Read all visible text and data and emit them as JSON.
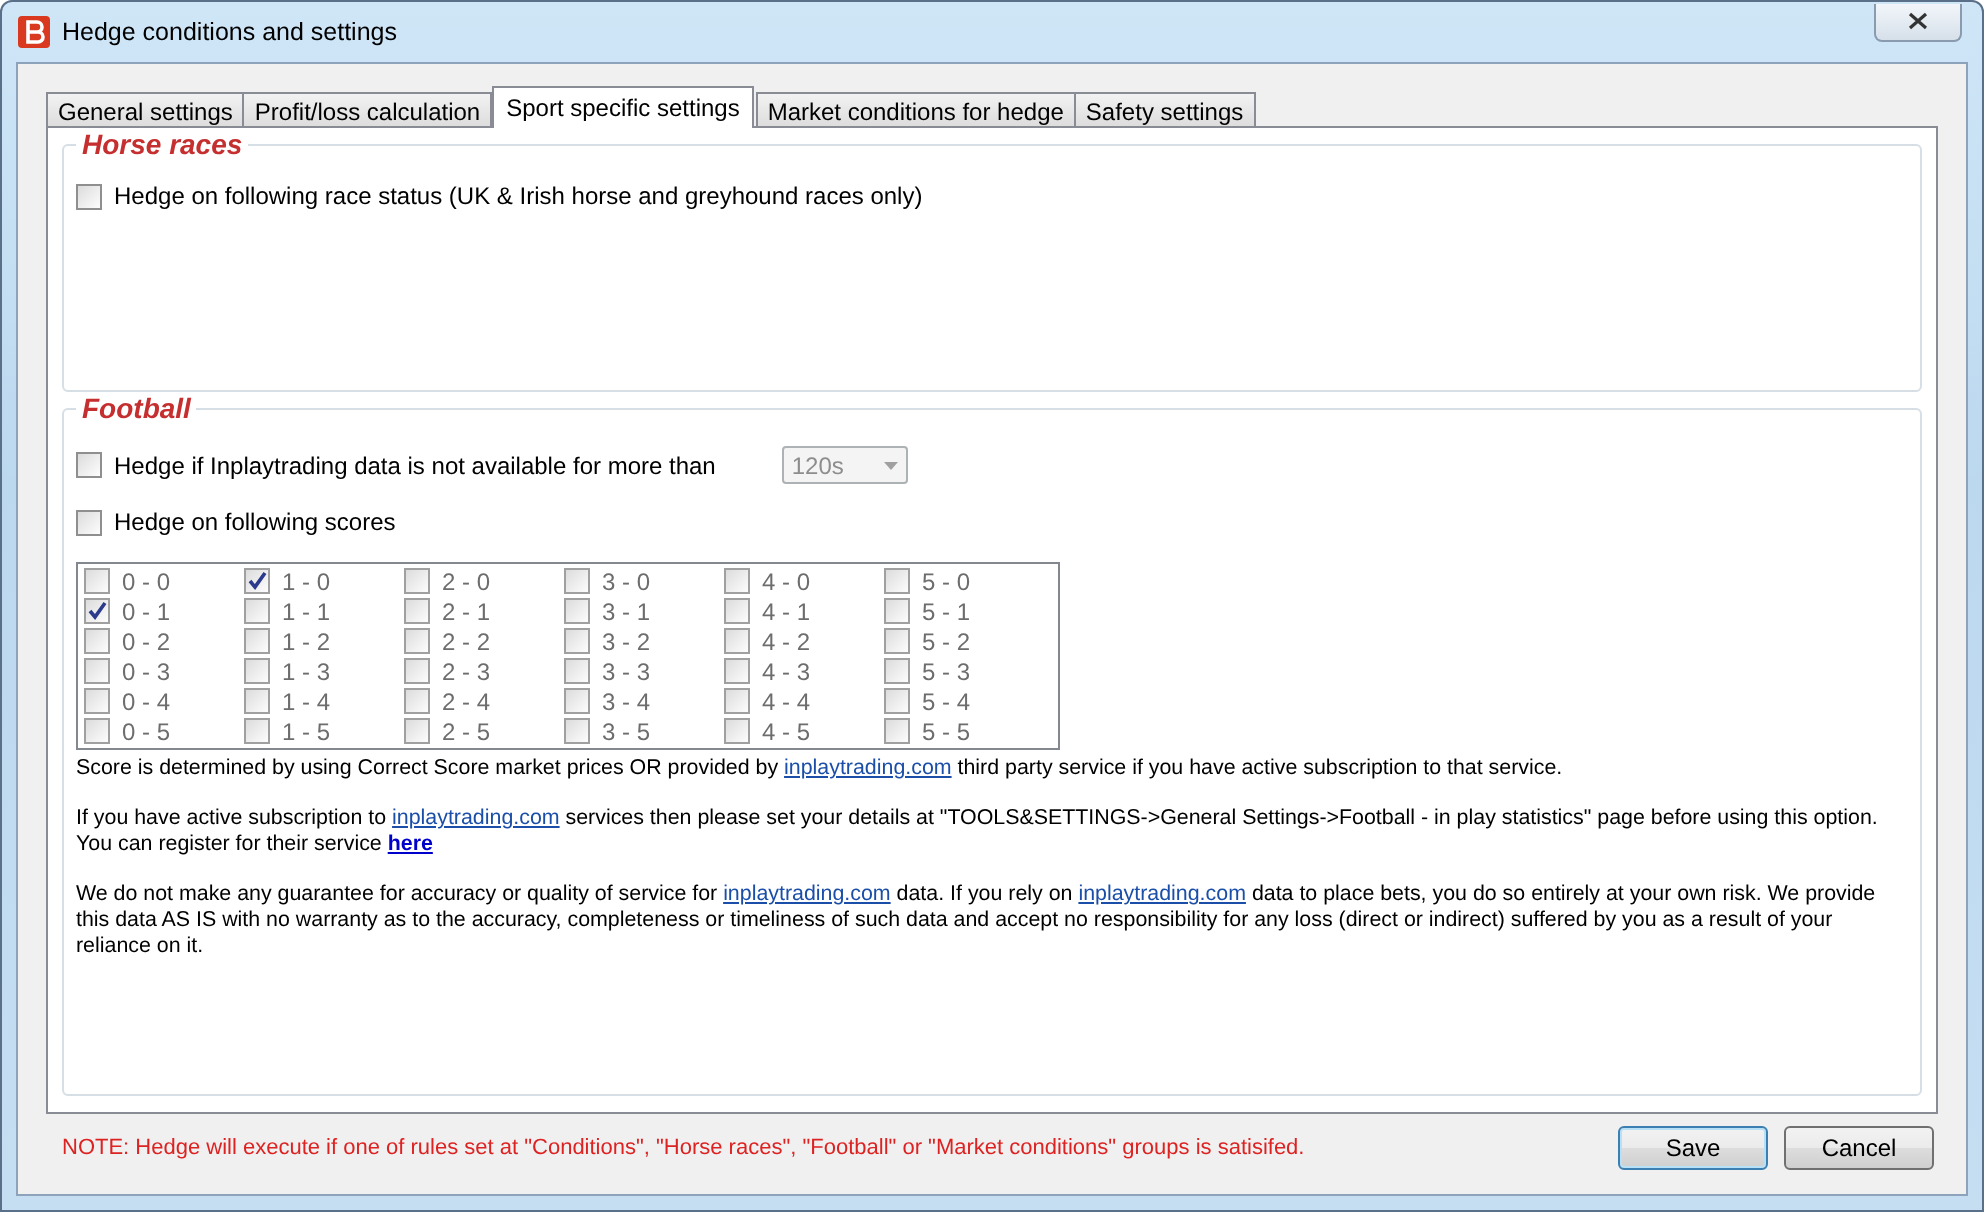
{
  "window": {
    "title": "Hedge conditions and settings"
  },
  "tabs": [
    {
      "label": "General settings",
      "selected": false
    },
    {
      "label": "Profit/loss calculation",
      "selected": false
    },
    {
      "label": "Sport specific settings",
      "selected": true
    },
    {
      "label": "Market conditions for hedge",
      "selected": false
    },
    {
      "label": "Safety settings",
      "selected": false
    }
  ],
  "horse_races": {
    "title": "Horse races",
    "options": [
      {
        "label": "Hedge on following race status (UK & Irish horse and greyhound races only)",
        "checked": false
      }
    ]
  },
  "football": {
    "title": "Football",
    "data_timeout": {
      "label": "Hedge if Inplaytrading data is not available for more than",
      "checked": false,
      "dropdown": {
        "value": "120s",
        "disabled": true
      }
    },
    "scores_option": {
      "label": "Hedge on following scores",
      "checked": false
    },
    "scores": [
      [
        {
          "label": "0 - 0",
          "checked": false
        },
        {
          "label": "1 - 0",
          "checked": true
        },
        {
          "label": "2 - 0",
          "checked": false
        },
        {
          "label": "3 - 0",
          "checked": false
        },
        {
          "label": "4 - 0",
          "checked": false
        },
        {
          "label": "5 - 0",
          "checked": false
        }
      ],
      [
        {
          "label": "0 - 1",
          "checked": true
        },
        {
          "label": "1 - 1",
          "checked": false
        },
        {
          "label": "2 - 1",
          "checked": false
        },
        {
          "label": "3 - 1",
          "checked": false
        },
        {
          "label": "4 - 1",
          "checked": false
        },
        {
          "label": "5 - 1",
          "checked": false
        }
      ],
      [
        {
          "label": "0 - 2",
          "checked": false
        },
        {
          "label": "1 - 2",
          "checked": false
        },
        {
          "label": "2 - 2",
          "checked": false
        },
        {
          "label": "3 - 2",
          "checked": false
        },
        {
          "label": "4 - 2",
          "checked": false
        },
        {
          "label": "5 - 2",
          "checked": false
        }
      ],
      [
        {
          "label": "0 - 3",
          "checked": false
        },
        {
          "label": "1 - 3",
          "checked": false
        },
        {
          "label": "2 - 3",
          "checked": false
        },
        {
          "label": "3 - 3",
          "checked": false
        },
        {
          "label": "4 - 3",
          "checked": false
        },
        {
          "label": "5 - 3",
          "checked": false
        }
      ],
      [
        {
          "label": "0 - 4",
          "checked": false
        },
        {
          "label": "1 - 4",
          "checked": false
        },
        {
          "label": "2 - 4",
          "checked": false
        },
        {
          "label": "3 - 4",
          "checked": false
        },
        {
          "label": "4 - 4",
          "checked": false
        },
        {
          "label": "5 - 4",
          "checked": false
        }
      ],
      [
        {
          "label": "0 - 5",
          "checked": false
        },
        {
          "label": "1 - 5",
          "checked": false
        },
        {
          "label": "2 - 5",
          "checked": false
        },
        {
          "label": "3 - 5",
          "checked": false
        },
        {
          "label": "4 - 5",
          "checked": false
        },
        {
          "label": "5 - 5",
          "checked": false
        }
      ]
    ],
    "paragraphs": [
      [
        {
          "kind": "text",
          "text": "Score is determined by using Correct Score market prices OR provided by "
        },
        {
          "kind": "link",
          "text": "inplaytrading.com"
        },
        {
          "kind": "text",
          "text": " third party service if you have active subscription to that service."
        }
      ],
      [
        {
          "kind": "text",
          "text": "If you have active subscription to "
        },
        {
          "kind": "link",
          "text": "inplaytrading.com"
        },
        {
          "kind": "text",
          "text": " services then please set your details at \"TOOLS&SETTINGS->General Settings->Football - in play statistics\" page before using this option. You can register for their service "
        },
        {
          "kind": "bold_link",
          "text": "here"
        }
      ],
      [
        {
          "kind": "text",
          "text": "We do not make any guarantee for accuracy or quality of service for "
        },
        {
          "kind": "link",
          "text": "inplaytrading.com"
        },
        {
          "kind": "text",
          "text": " data. If you rely on "
        },
        {
          "kind": "link",
          "text": "inplaytrading.com"
        },
        {
          "kind": "text",
          "text": " data to place bets, you do so entirely at your own risk. We provide this data AS IS with no warranty as to the accuracy, completeness or timeliness of such data and accept no responsibility for any loss (direct or indirect) suffered by you as a result of your reliance on it."
        }
      ]
    ]
  },
  "note": "NOTE: Hedge will execute if one of rules set at \"Conditions\", \"Horse races\", \"Football\" or \"Market conditions\" groups is satisifed.",
  "buttons": [
    {
      "label": "Save",
      "default": true
    },
    {
      "label": "Cancel",
      "default": false
    }
  ]
}
